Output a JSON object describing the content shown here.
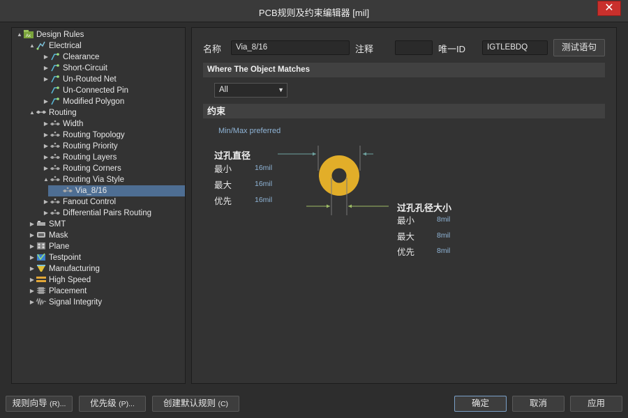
{
  "window": {
    "title": "PCB规则及约束编辑器 [mil]",
    "close_glyph": "✕"
  },
  "tree": [
    {
      "label": "Design Rules",
      "level": 0,
      "twisty": "▲",
      "icon": "design-rules-icon",
      "selected": false
    },
    {
      "label": "Electrical",
      "level": 1,
      "twisty": "▲",
      "icon": "electrical-icon",
      "selected": false
    },
    {
      "label": "Clearance",
      "level": 2,
      "twisty": "▶",
      "icon": "clearance-icon",
      "selected": false
    },
    {
      "label": "Short-Circuit",
      "level": 2,
      "twisty": "▶",
      "icon": "short-circuit-icon",
      "selected": false
    },
    {
      "label": "Un-Routed Net",
      "level": 2,
      "twisty": "▶",
      "icon": "unrouted-net-icon",
      "selected": false
    },
    {
      "label": "Un-Connected Pin",
      "level": 2,
      "twisty": "",
      "icon": "unconnected-pin-icon",
      "selected": false
    },
    {
      "label": "Modified Polygon",
      "level": 2,
      "twisty": "▶",
      "icon": "modified-polygon-icon",
      "selected": false
    },
    {
      "label": "Routing",
      "level": 1,
      "twisty": "▲",
      "icon": "routing-icon",
      "selected": false
    },
    {
      "label": "Width",
      "level": 2,
      "twisty": "▶",
      "icon": "routing-rule-icon",
      "selected": false
    },
    {
      "label": "Routing Topology",
      "level": 2,
      "twisty": "▶",
      "icon": "routing-rule-icon",
      "selected": false
    },
    {
      "label": "Routing Priority",
      "level": 2,
      "twisty": "▶",
      "icon": "routing-rule-icon",
      "selected": false
    },
    {
      "label": "Routing Layers",
      "level": 2,
      "twisty": "▶",
      "icon": "routing-rule-icon",
      "selected": false
    },
    {
      "label": "Routing Corners",
      "level": 2,
      "twisty": "▶",
      "icon": "routing-rule-icon",
      "selected": false
    },
    {
      "label": "Routing Via Style",
      "level": 2,
      "twisty": "▲",
      "icon": "routing-rule-icon",
      "selected": false
    },
    {
      "label": "Via_8/16",
      "level": 3,
      "twisty": "",
      "icon": "routing-rule-icon",
      "selected": true
    },
    {
      "label": "Fanout Control",
      "level": 2,
      "twisty": "▶",
      "icon": "routing-rule-icon",
      "selected": false
    },
    {
      "label": "Differential Pairs Routing",
      "level": 2,
      "twisty": "▶",
      "icon": "routing-rule-icon",
      "selected": false
    },
    {
      "label": "SMT",
      "level": 1,
      "twisty": "▶",
      "icon": "smt-icon",
      "selected": false
    },
    {
      "label": "Mask",
      "level": 1,
      "twisty": "▶",
      "icon": "mask-icon",
      "selected": false
    },
    {
      "label": "Plane",
      "level": 1,
      "twisty": "▶",
      "icon": "plane-icon",
      "selected": false
    },
    {
      "label": "Testpoint",
      "level": 1,
      "twisty": "▶",
      "icon": "testpoint-icon",
      "selected": false
    },
    {
      "label": "Manufacturing",
      "level": 1,
      "twisty": "▶",
      "icon": "manufacturing-icon",
      "selected": false
    },
    {
      "label": "High Speed",
      "level": 1,
      "twisty": "▶",
      "icon": "high-speed-icon",
      "selected": false
    },
    {
      "label": "Placement",
      "level": 1,
      "twisty": "▶",
      "icon": "placement-icon",
      "selected": false
    },
    {
      "label": "Signal Integrity",
      "level": 1,
      "twisty": "▶",
      "icon": "signal-integrity-icon",
      "selected": false
    }
  ],
  "form": {
    "name_label": "名称",
    "name_value": "Via_8/16",
    "comment_label": "注释",
    "comment_value": "",
    "uid_label": "唯一ID",
    "uid_value": "IGTLEBDQ",
    "test_button": "测试语句"
  },
  "match": {
    "section_title": "Where The Object Matches",
    "selected_option": "All",
    "caret": "▼"
  },
  "constraints": {
    "section_title": "约束",
    "mode": "Min/Max preferred",
    "via_diameter": {
      "title": "过孔直径",
      "min_label": "最小",
      "min_value": "16mil",
      "max_label": "最大",
      "max_value": "16mil",
      "pref_label": "优先",
      "pref_value": "16mil"
    },
    "hole_size": {
      "title": "过孔孔径大小",
      "min_label": "最小",
      "min_value": "8mil",
      "max_label": "最大",
      "max_value": "8mil",
      "pref_label": "优先",
      "pref_value": "8mil"
    }
  },
  "colors": {
    "via_ring": "#e2ae29",
    "accent": "#4e6e93",
    "arrow": "#6fa3a0",
    "arrow_hole": "#9fbe66"
  },
  "buttons": {
    "rule_wizard": "规则向导",
    "rule_wizard_key": "(R)...",
    "priority": "优先级",
    "priority_key": "(P)...",
    "default_rules": "创建默认规则",
    "default_rules_key": "(C)",
    "ok": "确定",
    "cancel": "取消",
    "apply": "应用"
  }
}
